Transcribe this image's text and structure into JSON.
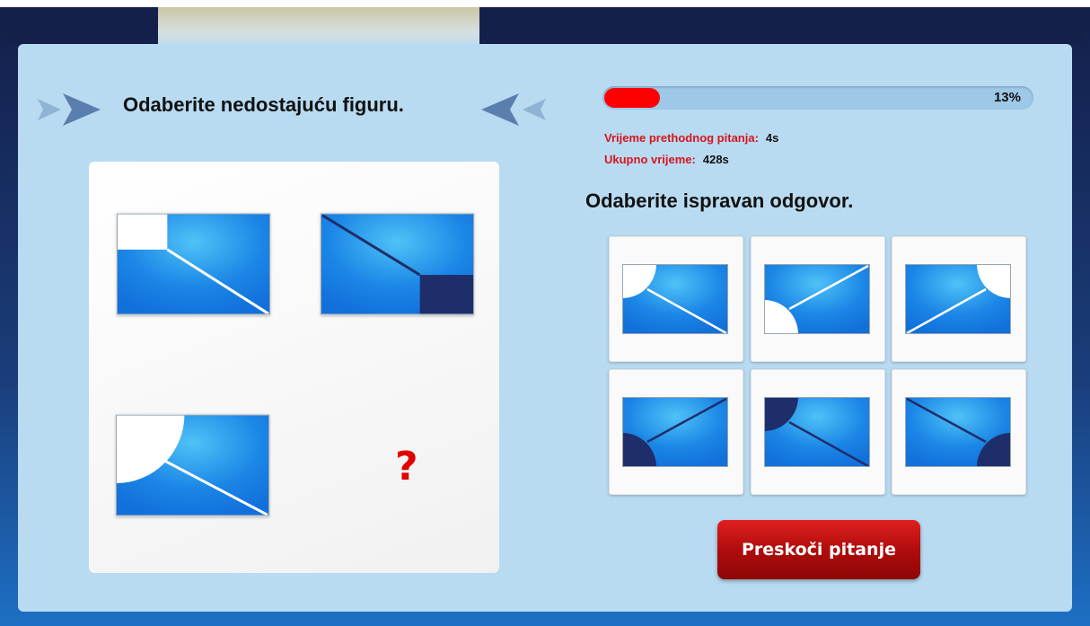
{
  "question": {
    "title": "Odaberite nedostajuću figuru.",
    "missing_mark": "?"
  },
  "progress": {
    "percent": 13,
    "label": "13%"
  },
  "stats": {
    "previous_label": "Vrijeme prethodnog pitanja:",
    "previous_value": "4s",
    "total_label": "Ukupno vrijeme:",
    "total_value": "428s"
  },
  "answers": {
    "title": "Odaberite ispravan odgovor.",
    "count": 6
  },
  "skip_button": {
    "label": "Preskoči pitanje"
  },
  "colors": {
    "tile_blue": "#1270db",
    "tile_light": "#4fc2f7",
    "dark_navy": "#1e2e6b",
    "accent_red": "#e00000",
    "panel": "#b8dbf1"
  },
  "icons": [
    "arrow-right-icon",
    "arrow-left-icon"
  ]
}
